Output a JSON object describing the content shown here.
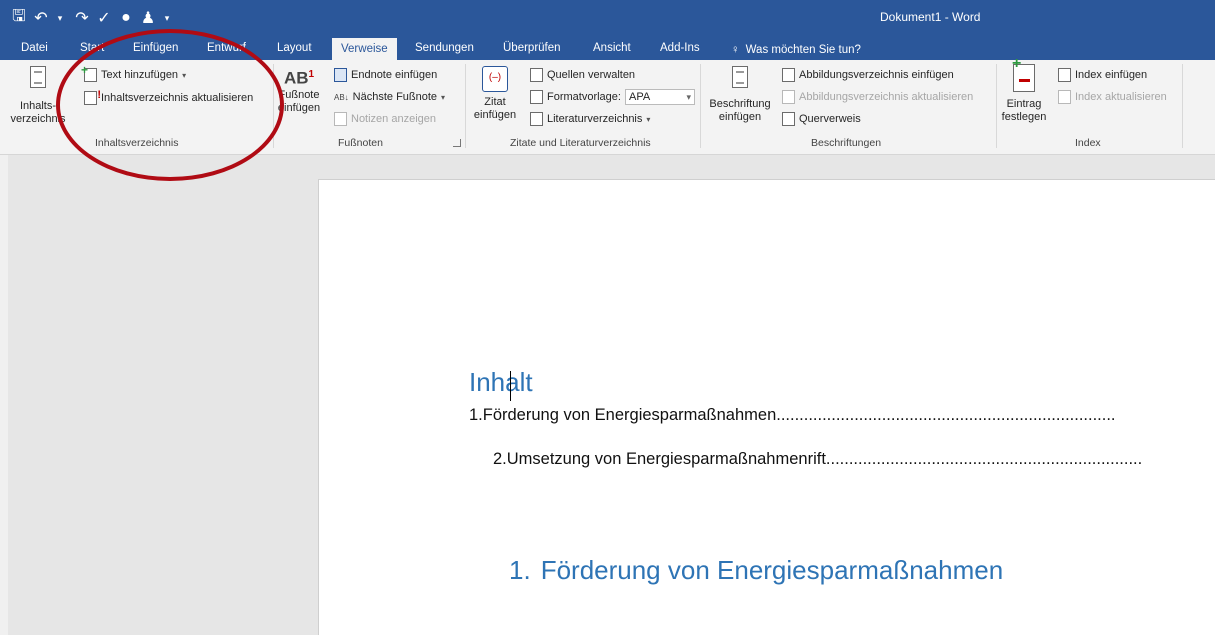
{
  "window": {
    "title": "Dokument1 - Word"
  },
  "qat": {
    "save": "🖫",
    "undo": "↶",
    "undo_arrow": "▾",
    "redo": "↷",
    "check": "✓",
    "circle": "●",
    "person": "♟",
    "customize": "▾"
  },
  "tabs": [
    "Datei",
    "Start",
    "Einfügen",
    "Entwurf",
    "Layout",
    "Verweise",
    "Sendungen",
    "Überprüfen",
    "Ansicht",
    "Add-Ins"
  ],
  "active_tab": "Verweise",
  "tell_me": {
    "icon": "lightbulb-icon",
    "placeholder": "Was möchten Sie tun?"
  },
  "ribbon": {
    "inhaltsverzeichnis": {
      "big_line1": "Inhalts-",
      "big_line2": "verzeichnis",
      "text_hinzufuegen": "Text hinzufügen",
      "aktualisieren": "Inhaltsverzeichnis aktualisieren",
      "label": "Inhaltsverzeichnis"
    },
    "fussnoten": {
      "big_line1": "Fußnote",
      "big_line2": "einfügen",
      "endnote": "Endnote einfügen",
      "naechste": "Nächste Fußnote",
      "notizen": "Notizen anzeigen",
      "label": "Fußnoten"
    },
    "zitate": {
      "big_line1": "Zitat",
      "big_line2": "einfügen",
      "quellen": "Quellen verwalten",
      "formatvorlage": "Formatvorlage:",
      "formatvorlage_value": "APA",
      "literatur": "Literaturverzeichnis",
      "label": "Zitate und Literaturverzeichnis"
    },
    "beschriftungen": {
      "big_line1": "Beschriftung",
      "big_line2": "einfügen",
      "abbildungsverzeichnis": "Abbildungsverzeichnis einfügen",
      "abb_aktualisieren": "Abbildungsverzeichnis aktualisieren",
      "querverweis": "Querverweis",
      "label": "Beschriftungen"
    },
    "index": {
      "big_line1": "Eintrag",
      "big_line2": "festlegen",
      "index_einfuegen": "Index einfügen",
      "index_aktualisieren": "Index aktualisieren",
      "label": "Index"
    }
  },
  "document": {
    "toc_heading": "Inhalt",
    "toc_entries": [
      "1.Förderung von Energiesparmaßnahmen..........................................................................",
      "2.Umsetzung von Energiesparmaßnahmenrift.....................................................................",
      ""
    ],
    "heading1_number": "1.",
    "heading1_text": "Förderung von Energiesparmaßnahmen"
  },
  "colors": {
    "brand": "#2b579a",
    "heading": "#2e74b5",
    "annotation": "#b00b14"
  }
}
